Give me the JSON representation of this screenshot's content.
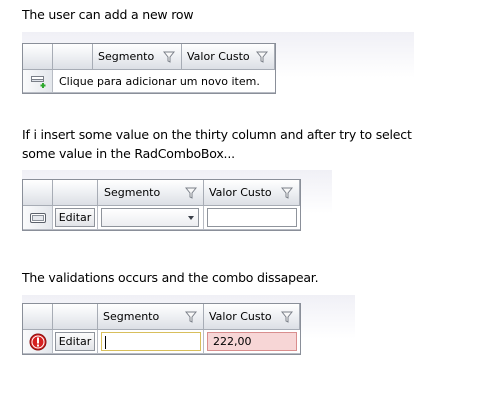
{
  "captions": {
    "one": "The user can add a new row",
    "two_line1": "If i insert some value on the thirty column and after try to select",
    "two_line2": "some value in the RadComboBox...",
    "three": "The validations occurs and the combo dissapear."
  },
  "grid1": {
    "columns": [
      "Segmento",
      "Valor Custo"
    ],
    "add_row_text": "Clique para adicionar um novo item."
  },
  "grid2": {
    "columns": [
      "Segmento",
      "Valor Custo"
    ],
    "edit_label": "Editar",
    "combo_value": "",
    "valor_value": ""
  },
  "grid3": {
    "columns": [
      "Segmento",
      "Valor Custo"
    ],
    "edit_label": "Editar",
    "segmento_value": "",
    "valor_value": "222,00"
  },
  "icons": [
    "filter-icon",
    "add-row-icon",
    "edit-row-indicator-icon",
    "combo-dropdown-icon",
    "error-icon"
  ],
  "colors": {
    "error_field_bg": "#f7d6d6",
    "error_icon": "#d62020",
    "focus_border": "#d8bf5c"
  }
}
